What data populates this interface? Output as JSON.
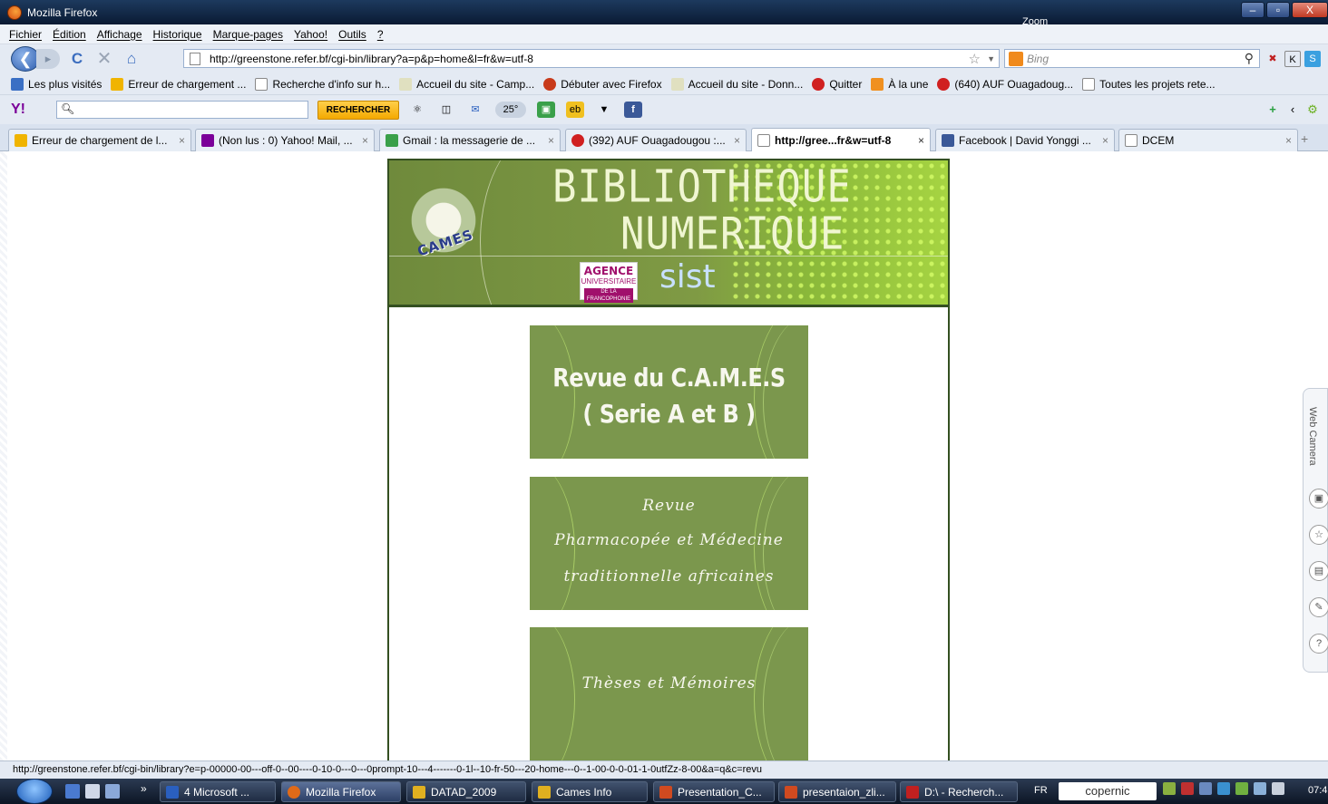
{
  "window": {
    "title": "Mozilla Firefox",
    "zoom_label": "Zoom",
    "buttons": {
      "minimize": "–",
      "maximize": "▫",
      "close": "X"
    }
  },
  "menu": {
    "items": [
      "Fichier",
      "Édition",
      "Affichage",
      "Historique",
      "Marque-pages",
      "Yahoo!",
      "Outils",
      "?"
    ]
  },
  "nav": {
    "back": "❮",
    "forward": "▸",
    "reload": "C",
    "stop": "✕",
    "home": "⌂",
    "url": "http://greenstone.refer.bf/cgi-bin/library?a=p&p=home&l=fr&w=utf-8",
    "star": "☆",
    "url_dropdown": "▼",
    "search_placeholder": "Bing",
    "search_icon": "⚲",
    "ext": [
      "✖",
      "K",
      "S"
    ]
  },
  "bookmarks": [
    {
      "label": "Les plus visités",
      "color": "#3a6fc4"
    },
    {
      "label": "Erreur de chargement ...",
      "color": "#f0b400"
    },
    {
      "label": "Recherche d'info sur h...",
      "color": "#ffffff"
    },
    {
      "label": "Accueil du site - Camp...",
      "color": "#e0e0c0"
    },
    {
      "label": "Débuter avec Firefox",
      "color": "#c83a1a"
    },
    {
      "label": "Accueil du site - Donn...",
      "color": "#e0e0c0"
    },
    {
      "label": "Quitter",
      "color": "#d02020"
    },
    {
      "label": "À la une",
      "color": "#f09020"
    },
    {
      "label": "(640) AUF Ouagadoug...",
      "color": "#d02020"
    },
    {
      "label": "Toutes les projets rete...",
      "color": "#ffffff"
    }
  ],
  "yahoo_toolbar": {
    "logo": "Y!",
    "search_icon": "🔍︎",
    "button": "RECHERCHER",
    "tools": [
      "⚛",
      "◫",
      "✉",
      "25°",
      "▣",
      "eb",
      "▼",
      "f"
    ],
    "right": [
      "+",
      "‹",
      "⚙"
    ]
  },
  "tabs": [
    {
      "label": "Erreur de chargement de l...",
      "color": "#f0b400",
      "active": false
    },
    {
      "label": "(Non lus : 0) Yahoo! Mail, ...",
      "color": "#7b0099",
      "active": false
    },
    {
      "label": "Gmail : la messagerie de ...",
      "color": "#3aa04a",
      "active": false
    },
    {
      "label": "(392) AUF Ouagadougou :...",
      "color": "#d02020",
      "active": false
    },
    {
      "label": "http://gree...fr&w=utf-8",
      "color": "#ffffff",
      "active": true
    },
    {
      "label": "Facebook | David Yonggi ...",
      "color": "#3b5998",
      "active": false
    },
    {
      "label": "DCEM",
      "color": "#ffffff",
      "active": false
    }
  ],
  "tab_close": "×",
  "tab_new": "+",
  "banner": {
    "logo_text": "CAMES",
    "title_line1": "BIBLIOTHEQUE",
    "title_line2": "NUMERIQUE",
    "auf_line1": "AGENCE",
    "auf_line2": "UNIVERSITAIRE",
    "auf_line3": "DE LA FRANCOPHONIE",
    "sist": "sist"
  },
  "collections": [
    {
      "line1": "Revue du C.A.M.E.S",
      "line2": "( Serie A et B )"
    },
    {
      "line1": "Revue",
      "line2": "Pharmacopée et Médecine",
      "line3": "traditionnelle africaines"
    },
    {
      "line1": "Thèses et Mémoires"
    }
  ],
  "side_widget": {
    "label": "Web Camera",
    "buttons": [
      "▣",
      "☆",
      "▤",
      "✎",
      "?"
    ]
  },
  "status_url": "http://greenstone.refer.bf/cgi-bin/library?e=p-00000-00---off-0--00----0-10-0---0---0prompt-10---4-------0-1l--10-fr-50---20-home---0--1-00-0-0-01-1-0utfZz-8-00&a=q&c=revu",
  "taskbar": {
    "overflow": "»",
    "items": [
      {
        "label": "4 Microsoft ...",
        "color": "#2a5fbf"
      },
      {
        "label": "Mozilla Firefox",
        "color": "#e06a18"
      },
      {
        "label": "DATAD_2009",
        "color": "#e0b020"
      },
      {
        "label": "Cames Info",
        "color": "#e0b020"
      },
      {
        "label": "Presentation_C...",
        "color": "#d04a20"
      },
      {
        "label": "presentaion_zli...",
        "color": "#d04a20"
      },
      {
        "label": "D:\\ - Recherch...",
        "color": "#c02020"
      }
    ],
    "lang": "FR",
    "search_text": "copernic",
    "clock": "07:4"
  }
}
